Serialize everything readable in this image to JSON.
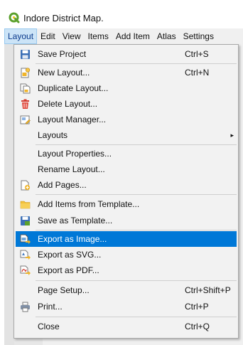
{
  "window": {
    "title": "Indore District Map."
  },
  "menubar": {
    "items": [
      {
        "label": "Layout",
        "active": true
      },
      {
        "label": "Edit"
      },
      {
        "label": "View"
      },
      {
        "label": "Items"
      },
      {
        "label": "Add Item"
      },
      {
        "label": "Atlas"
      },
      {
        "label": "Settings"
      }
    ]
  },
  "layout_menu": {
    "items": [
      {
        "label": "Save Project",
        "shortcut": "Ctrl+S",
        "icon": "save-icon"
      },
      {
        "label": "New Layout...",
        "shortcut": "Ctrl+N",
        "icon": "new-layout-icon"
      },
      {
        "label": "Duplicate Layout...",
        "icon": "duplicate-layout-icon"
      },
      {
        "label": "Delete Layout...",
        "icon": "trash-icon"
      },
      {
        "label": "Layout Manager...",
        "icon": "layout-manager-icon"
      },
      {
        "label": "Layouts",
        "submenu": true
      },
      {
        "label": "Layout Properties..."
      },
      {
        "label": "Rename Layout..."
      },
      {
        "label": "Add Pages...",
        "icon": "add-pages-icon"
      },
      {
        "label": "Add Items from Template...",
        "icon": "folder-icon"
      },
      {
        "label": "Save as Template...",
        "icon": "save-template-icon"
      },
      {
        "label": "Export as Image...",
        "icon": "export-image-icon",
        "highlighted": true
      },
      {
        "label": "Export as SVG...",
        "icon": "export-svg-icon"
      },
      {
        "label": "Export as PDF...",
        "icon": "export-pdf-icon"
      },
      {
        "label": "Page Setup...",
        "shortcut": "Ctrl+Shift+P"
      },
      {
        "label": "Print...",
        "shortcut": "Ctrl+P",
        "icon": "printer-icon"
      },
      {
        "label": "Close",
        "shortcut": "Ctrl+Q"
      }
    ],
    "submenu_arrow": "▸"
  },
  "colors": {
    "highlight": "#0078d7",
    "menubar_active": "#cce4f7",
    "logo_green": "#5aa02c"
  }
}
